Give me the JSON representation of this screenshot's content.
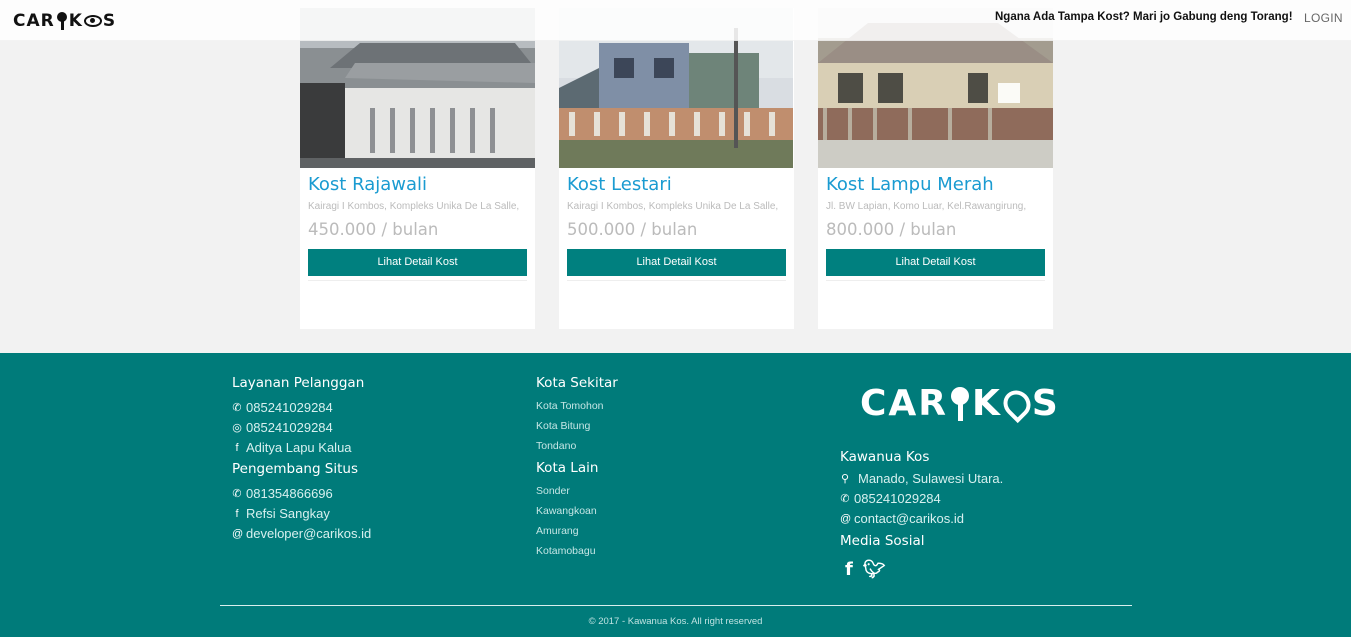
{
  "nav": {
    "logo_text": "CARIKOS",
    "cta": "Ngana Ada Tampa Kost? Mari jo Gabung deng Torang!",
    "login": "LOGIN"
  },
  "cards": [
    {
      "title": "Kost Rajawali",
      "address": "Kairagi I Kombos, Kompleks Unika De La Salle,",
      "price": "450.000 / bulan",
      "button": "Lihat Detail Kost"
    },
    {
      "title": "Kost Lestari",
      "address": "Kairagi I Kombos, Kompleks Unika De La Salle,",
      "price": "500.000 / bulan",
      "button": "Lihat Detail Kost"
    },
    {
      "title": "Kost Lampu Merah",
      "address": "Jl. BW Lapian, Komo Luar, Kel.Rawangirung,",
      "price": "800.000 / bulan",
      "button": "Lihat Detail Kost"
    }
  ],
  "footer": {
    "col1": {
      "heading1": "Layanan Pelanggan",
      "phone": "085241029284",
      "whatsapp": "085241029284",
      "facebook": "Aditya Lapu Kalua",
      "heading2": "Pengembang Situs",
      "dev_phone": "081354866696",
      "dev_facebook": "Refsi Sangkay",
      "dev_email": "developer@carikos.id"
    },
    "col2": {
      "heading1": "Kota Sekitar",
      "nearby": [
        "Kota Tomohon",
        "Kota Bitung",
        "Tondano"
      ],
      "heading2": "Kota Lain",
      "others": [
        "Sonder",
        "Kawangkoan",
        "Amurang",
        "Kotamobagu"
      ]
    },
    "col3": {
      "logo_text": "CARIKOS",
      "heading1": "Kawanua Kos",
      "location": "Manado, Sulawesi Utara.",
      "phone": "085241029284",
      "email": "contact@carikos.id",
      "heading2": "Media Sosial"
    },
    "copyright": "© 2017 - Kawanua Kos. All right reserved"
  }
}
